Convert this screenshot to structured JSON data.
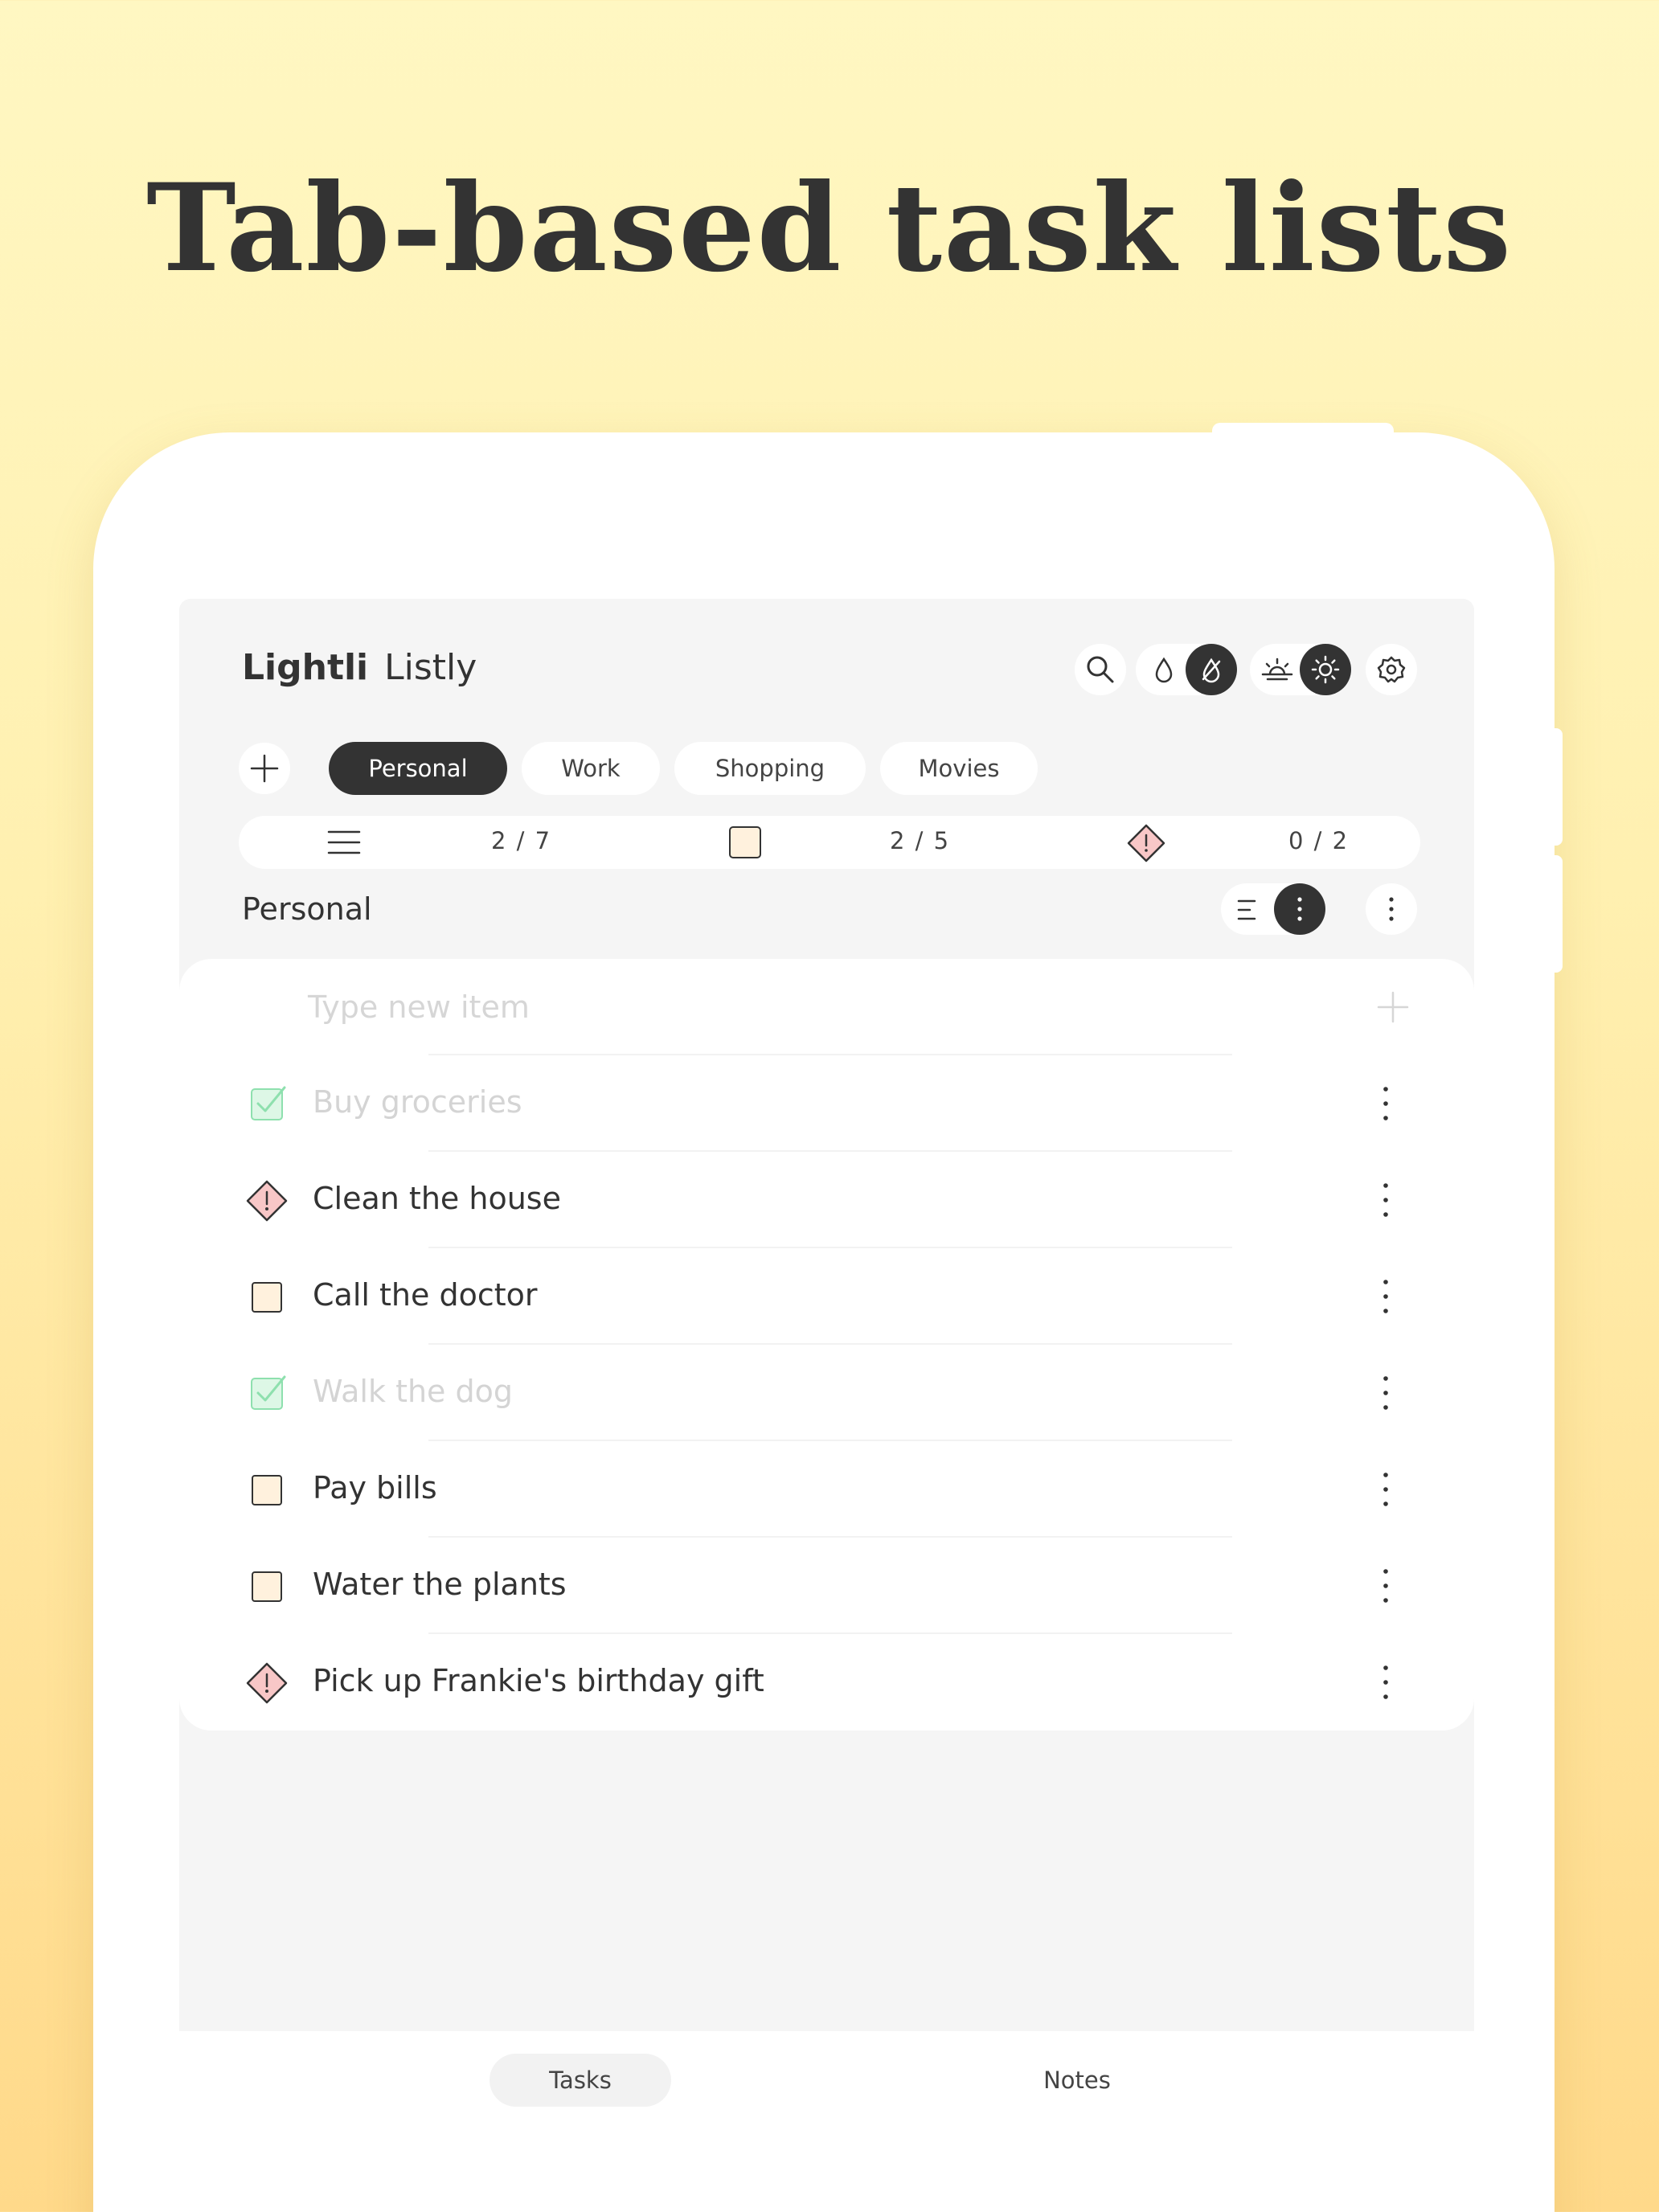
{
  "headline": "Tab-based task lists",
  "app": {
    "brand_bold": "Lightli",
    "brand_regular": "Listly"
  },
  "toolbar": {
    "icons": [
      "search-icon",
      "water-drop-icon",
      "no-drop-icon",
      "sunrise-icon",
      "sun-icon",
      "gear-icon"
    ]
  },
  "tabs": [
    {
      "label": "Personal",
      "active": true
    },
    {
      "label": "Work",
      "active": false
    },
    {
      "label": "Shopping",
      "active": false
    },
    {
      "label": "Movies",
      "active": false
    }
  ],
  "stats": {
    "all": "2 / 7",
    "todo": "2 / 5",
    "important": "0 / 2"
  },
  "list": {
    "title": "Personal",
    "new_item_placeholder": "Type new item",
    "items": [
      {
        "label": "Buy groceries",
        "status": "done"
      },
      {
        "label": "Clean the house",
        "status": "important"
      },
      {
        "label": "Call the doctor",
        "status": "todo"
      },
      {
        "label": "Walk the dog",
        "status": "done"
      },
      {
        "label": "Pay bills",
        "status": "todo"
      },
      {
        "label": "Water the plants",
        "status": "todo"
      },
      {
        "label": "Pick up Frankie's birthday gift",
        "status": "important"
      }
    ]
  },
  "nav": {
    "tasks": "Tasks",
    "notes": "Notes",
    "active": "tasks"
  },
  "colors": {
    "dark": "#333333",
    "todo_fill": "#FFF1DD",
    "important_fill": "#F8C7C7",
    "done_fill": "#DDF7E6",
    "done_check": "#8EE0AE"
  }
}
